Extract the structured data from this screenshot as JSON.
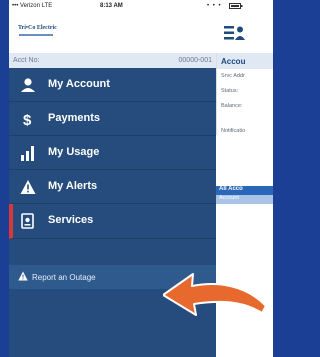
{
  "status_bar": {
    "carrier": "••• Verizon LTE",
    "time": "8:13 AM",
    "signal_dots": "• • •"
  },
  "menu": {
    "logo_text": "Tri•Co Electric",
    "account_label": "Acct No:",
    "account_number": "00000-001",
    "items": [
      {
        "label": "My Account",
        "icon": "user-icon"
      },
      {
        "label": "Payments",
        "icon": "dollar-icon"
      },
      {
        "label": "My Usage",
        "icon": "usage-bars-icon"
      },
      {
        "label": "My Alerts",
        "icon": "alert-triangle-icon"
      },
      {
        "label": "Services",
        "icon": "services-document-icon",
        "active": true
      }
    ],
    "sub_items": [
      {
        "label": "Report an Outage",
        "icon": "warning-icon"
      }
    ]
  },
  "app_behind": {
    "account_title": "Accou",
    "rows": [
      "Srvc Addr",
      "Status:",
      "Balance:",
      "Notificatio"
    ],
    "all_accounts": "All Acco",
    "account_col": "Account"
  },
  "colors": {
    "menu_bg": "#254c7c",
    "accent_red": "#d9383a",
    "arrow_orange": "#e8692e",
    "page_bg": "#1b3f95"
  }
}
